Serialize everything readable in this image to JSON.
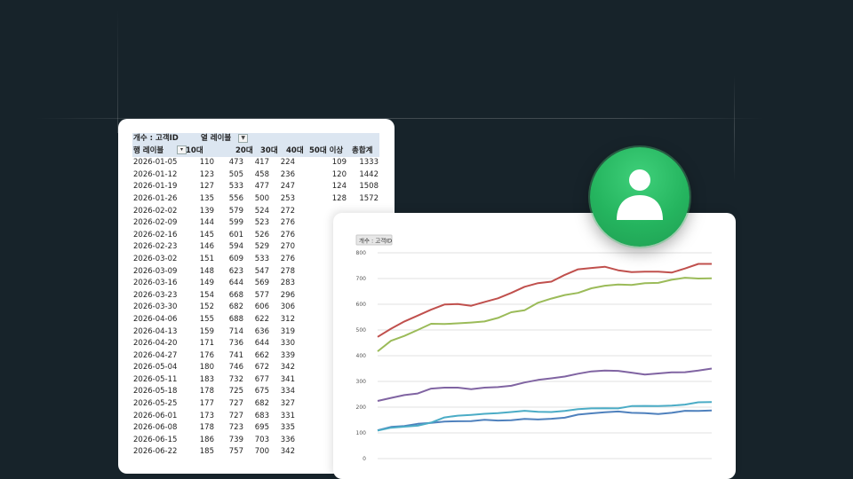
{
  "pivot": {
    "header1": {
      "field": "개수 : 고객ID",
      "col_label": "열 레이블"
    },
    "header2": {
      "row_label": "행 레이블",
      "cols": [
        "10대",
        "20대",
        "30대",
        "40대",
        "50대 이상",
        "총합계"
      ]
    },
    "rows": [
      [
        "2026-01-05",
        "110",
        "473",
        "417",
        "224",
        "109",
        "1333"
      ],
      [
        "2026-01-12",
        "123",
        "505",
        "458",
        "236",
        "120",
        "1442"
      ],
      [
        "2026-01-19",
        "127",
        "533",
        "477",
        "247",
        "124",
        "1508"
      ],
      [
        "2026-01-26",
        "135",
        "556",
        "500",
        "253",
        "128",
        "1572"
      ],
      [
        "2026-02-02",
        "139",
        "579",
        "524",
        "272",
        "",
        ""
      ],
      [
        "2026-02-09",
        "144",
        "599",
        "523",
        "276",
        "",
        ""
      ],
      [
        "2026-02-16",
        "145",
        "601",
        "526",
        "276",
        "",
        ""
      ],
      [
        "2026-02-23",
        "146",
        "594",
        "529",
        "270",
        "",
        ""
      ],
      [
        "2026-03-02",
        "151",
        "609",
        "533",
        "276",
        "",
        ""
      ],
      [
        "2026-03-09",
        "148",
        "623",
        "547",
        "278",
        "",
        ""
      ],
      [
        "2026-03-16",
        "149",
        "644",
        "569",
        "283",
        "",
        ""
      ],
      [
        "2026-03-23",
        "154",
        "668",
        "577",
        "296",
        "",
        ""
      ],
      [
        "2026-03-30",
        "152",
        "682",
        "606",
        "306",
        "",
        ""
      ],
      [
        "2026-04-06",
        "155",
        "688",
        "622",
        "312",
        "",
        ""
      ],
      [
        "2026-04-13",
        "159",
        "714",
        "636",
        "319",
        "",
        ""
      ],
      [
        "2026-04-20",
        "171",
        "736",
        "644",
        "330",
        "",
        ""
      ],
      [
        "2026-04-27",
        "176",
        "741",
        "662",
        "339",
        "",
        ""
      ],
      [
        "2026-05-04",
        "180",
        "746",
        "672",
        "342",
        "",
        ""
      ],
      [
        "2026-05-11",
        "183",
        "732",
        "677",
        "341",
        "",
        ""
      ],
      [
        "2026-05-18",
        "178",
        "725",
        "675",
        "334",
        "",
        ""
      ],
      [
        "2026-05-25",
        "177",
        "727",
        "682",
        "327",
        "",
        ""
      ],
      [
        "2026-06-01",
        "173",
        "727",
        "683",
        "331",
        "",
        ""
      ],
      [
        "2026-06-08",
        "178",
        "723",
        "695",
        "335",
        "",
        ""
      ],
      [
        "2026-06-15",
        "186",
        "739",
        "703",
        "336",
        "",
        ""
      ],
      [
        "2026-06-22",
        "185",
        "757",
        "700",
        "342",
        "",
        ""
      ]
    ]
  },
  "chart": {
    "field_button": "개수 : 고객ID"
  },
  "chart_data": {
    "type": "line",
    "ylim": [
      0,
      800
    ],
    "yticks": [
      "0",
      "100",
      "200",
      "300",
      "400",
      "500",
      "600",
      "700",
      "800"
    ],
    "grid": true,
    "colors": [
      "#4f81bd",
      "#c0504d",
      "#9bbb59",
      "#8064a2",
      "#4bacc6"
    ],
    "series": [
      {
        "values": [
          110,
          123,
          127,
          135,
          139,
          144,
          145,
          146,
          151,
          148,
          149,
          154,
          152,
          155,
          159,
          171,
          176,
          180,
          183,
          178,
          177,
          173,
          178,
          186,
          185,
          187
        ]
      },
      {
        "values": [
          473,
          505,
          533,
          556,
          579,
          599,
          601,
          594,
          609,
          623,
          644,
          668,
          682,
          688,
          714,
          736,
          741,
          746,
          732,
          725,
          727,
          727,
          723,
          739,
          757,
          757
        ]
      },
      {
        "values": [
          417,
          458,
          477,
          500,
          524,
          523,
          526,
          529,
          533,
          547,
          569,
          577,
          606,
          622,
          636,
          644,
          662,
          672,
          677,
          675,
          682,
          683,
          695,
          703,
          700,
          701
        ]
      },
      {
        "values": [
          224,
          236,
          247,
          253,
          272,
          276,
          276,
          270,
          276,
          278,
          283,
          296,
          306,
          312,
          319,
          330,
          339,
          342,
          341,
          334,
          327,
          331,
          335,
          336,
          342,
          350
        ]
      },
      {
        "values": [
          109,
          120,
          124,
          128,
          140,
          160,
          167,
          170,
          174,
          177,
          181,
          186,
          182,
          181,
          185,
          192,
          195,
          196,
          195,
          204,
          205,
          204,
          206,
          210,
          219,
          220
        ]
      }
    ]
  },
  "icons": {
    "avatar": "user-icon"
  }
}
